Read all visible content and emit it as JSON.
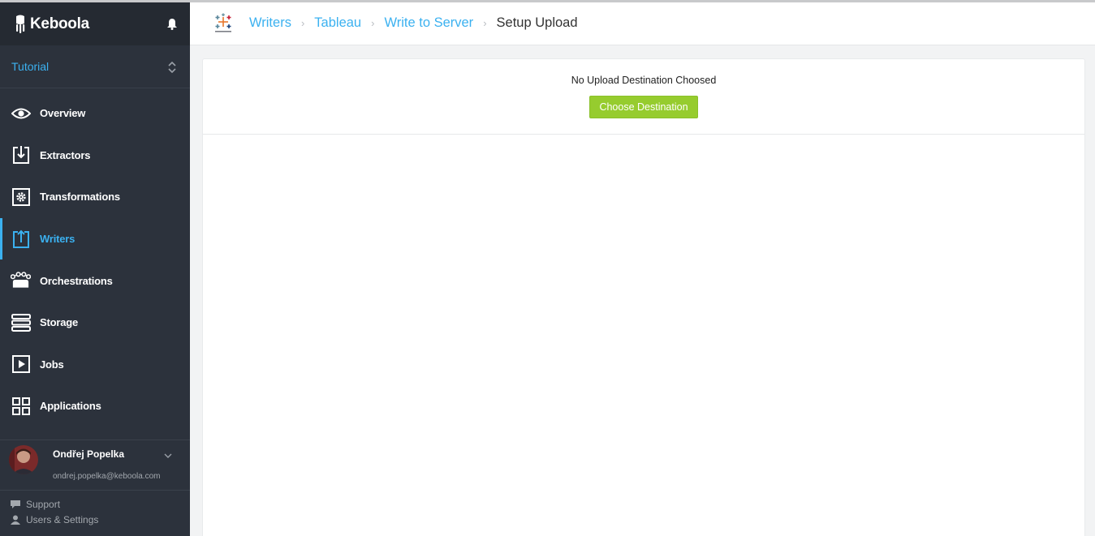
{
  "app": {
    "name": "Keboola"
  },
  "project": {
    "name": "Tutorial"
  },
  "nav": {
    "items": [
      {
        "label": "Overview",
        "icon": "eye-icon",
        "active": false
      },
      {
        "label": "Extractors",
        "icon": "download-box-icon",
        "active": false
      },
      {
        "label": "Transformations",
        "icon": "gear-box-icon",
        "active": false
      },
      {
        "label": "Writers",
        "icon": "upload-box-icon",
        "active": true
      },
      {
        "label": "Orchestrations",
        "icon": "orchestration-icon",
        "active": false
      },
      {
        "label": "Storage",
        "icon": "storage-icon",
        "active": false
      },
      {
        "label": "Jobs",
        "icon": "play-box-icon",
        "active": false
      },
      {
        "label": "Applications",
        "icon": "grid-icon",
        "active": false
      }
    ]
  },
  "user": {
    "name": "Ondřej Popelka",
    "email": "ondrej.popelka@keboola.com"
  },
  "footer": {
    "support": "Support",
    "settings": "Users & Settings"
  },
  "breadcrumb": {
    "items": [
      "Writers",
      "Tableau",
      "Write to Server"
    ],
    "current": "Setup Upload"
  },
  "main": {
    "empty_message": "No Upload Destination Choosed",
    "choose_button": "Choose Destination"
  },
  "colors": {
    "sidebar_bg": "#2c323c",
    "accent_blue": "#3bb1f0",
    "button_green": "#96cc2e"
  }
}
